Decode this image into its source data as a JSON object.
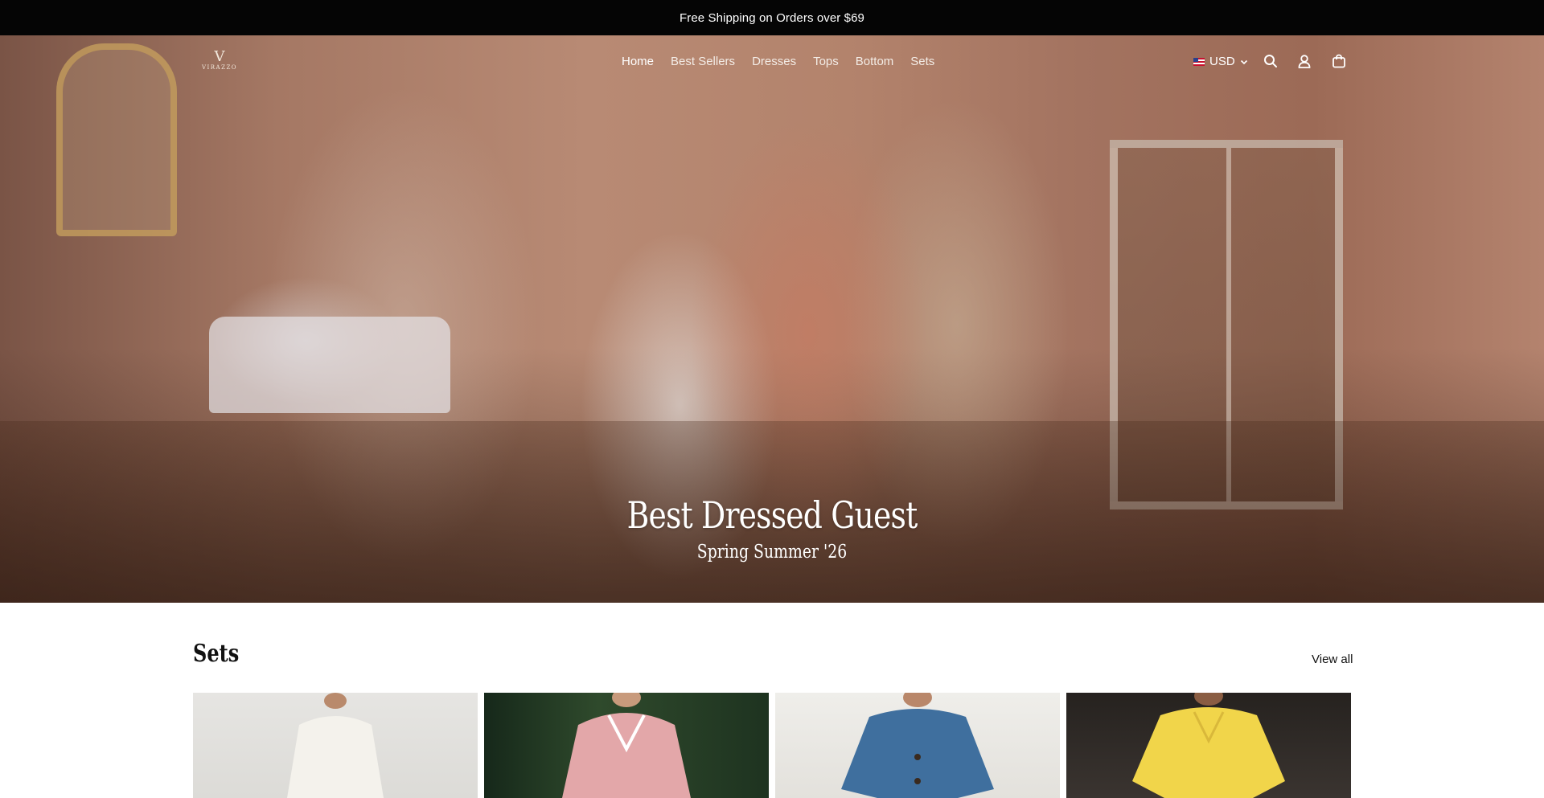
{
  "announcement": {
    "text": "Free Shipping on Orders over $69"
  },
  "brand": {
    "logo_mark": "V",
    "logo_word": "VIRAZZO"
  },
  "nav": {
    "items": [
      {
        "label": "Home",
        "active": true
      },
      {
        "label": "Best Sellers",
        "active": false
      },
      {
        "label": "Dresses",
        "active": false
      },
      {
        "label": "Tops",
        "active": false
      },
      {
        "label": "Bottom",
        "active": false
      },
      {
        "label": "Sets",
        "active": false
      }
    ]
  },
  "header_actions": {
    "currency": "USD",
    "icons": [
      "search-icon",
      "account-icon",
      "cart-icon"
    ]
  },
  "hero": {
    "title": "Best Dressed Guest",
    "subtitle": "Spring Summer '26"
  },
  "sets_section": {
    "title": "Sets",
    "view_all_label": "View all",
    "products": [
      {
        "top_color": "#f4f2ec"
      },
      {
        "top_color": "#e3a7a9"
      },
      {
        "top_color": "#3f6f9e"
      },
      {
        "top_color": "#f1d54a"
      }
    ]
  },
  "colors": {
    "announcement_bg": "#050505",
    "text_on_dark": "#ffffff",
    "page_bg": "#ffffff"
  }
}
